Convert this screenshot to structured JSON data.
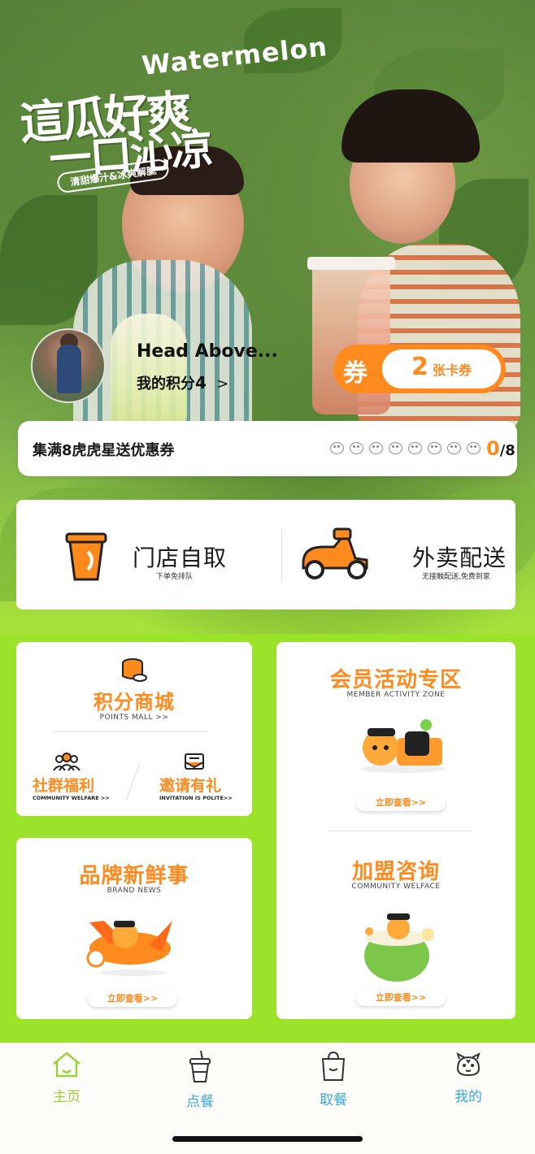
{
  "hero": {
    "promo_en": "Watermelon",
    "promo_cn_line1": "這瓜好爽",
    "promo_cn_line2": "一口沁凉",
    "promo_sub": "清甜爆汁&冰爽解腻"
  },
  "user": {
    "name": "Head Above...",
    "points_label": "我的积分",
    "points_value": "4",
    "points_chevron": ">"
  },
  "coupon": {
    "icon_text": "券",
    "count": "2",
    "unit": "张卡券"
  },
  "stamps": {
    "title": "集满8虎虎星送优惠券",
    "current": "0",
    "total": "/8",
    "slots": 8
  },
  "order": {
    "pickup": {
      "label": "门店自取",
      "sub": "下单免排队"
    },
    "delivery": {
      "label": "外卖配送",
      "sub": "无接触配送,免费到家"
    }
  },
  "cards": {
    "points_mall": {
      "title": "积分商城",
      "sub": "POINTS MALL  >>"
    },
    "community": {
      "title": "社群福利",
      "sub": "COMMUNITY WELFARE >>"
    },
    "invite": {
      "title": "邀请有礼",
      "sub": "INVITATION IS POLITE>>"
    },
    "member_zone": {
      "title": "会员活动专区",
      "sub": "MEMBER ACTIVITY ZONE",
      "btn": "立即查看>>"
    },
    "brand_news": {
      "title": "品牌新鲜事",
      "sub": "BRAND NEWS",
      "btn": "立即查看>>"
    },
    "franchise": {
      "title": "加盟咨询",
      "sub": "COMMUNITY WELFACE",
      "btn": "立即查看>>"
    }
  },
  "tabbar": {
    "home": "主页",
    "order": "点餐",
    "pickup": "取餐",
    "mine": "我的"
  },
  "colors": {
    "accent": "#ff8a1e",
    "background": "#9be22a",
    "tab_active": "#9bcf3c",
    "tab_inactive": "#3aa7e0"
  }
}
